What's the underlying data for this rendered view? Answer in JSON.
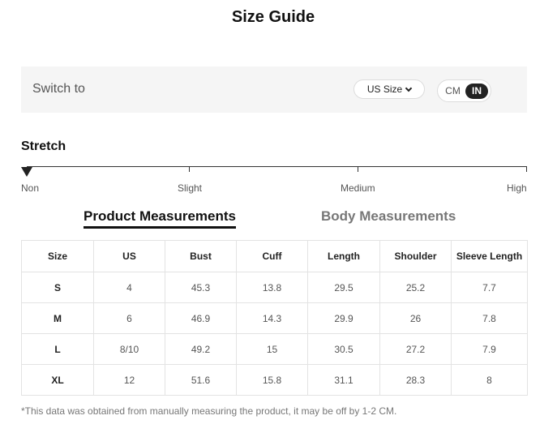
{
  "title": "Size Guide",
  "switch": {
    "label": "Switch to",
    "size_system": "US Size",
    "units": [
      "CM",
      "IN"
    ],
    "active_unit": "IN"
  },
  "stretch": {
    "title": "Stretch",
    "levels": [
      "Non",
      "Slight",
      "Medium",
      "High"
    ],
    "selected": "Non"
  },
  "tabs": [
    {
      "label": "Product Measurements",
      "active": true
    },
    {
      "label": "Body Measurements",
      "active": false
    }
  ],
  "table": {
    "headers": [
      "Size",
      "US",
      "Bust",
      "Cuff",
      "Length",
      "Shoulder",
      "Sleeve Length"
    ],
    "rows": [
      [
        "S",
        "4",
        "45.3",
        "13.8",
        "29.5",
        "25.2",
        "7.7"
      ],
      [
        "M",
        "6",
        "46.9",
        "14.3",
        "29.9",
        "26",
        "7.8"
      ],
      [
        "L",
        "8/10",
        "49.2",
        "15",
        "30.5",
        "27.2",
        "7.9"
      ],
      [
        "XL",
        "12",
        "51.6",
        "15.8",
        "31.1",
        "28.3",
        "8"
      ]
    ]
  },
  "note": "*This data was obtained from manually measuring the product, it may be off by 1-2 CM.",
  "colors": {
    "accent": "#222222",
    "panel": "#f5f5f5",
    "border": "#e3e3e3"
  }
}
